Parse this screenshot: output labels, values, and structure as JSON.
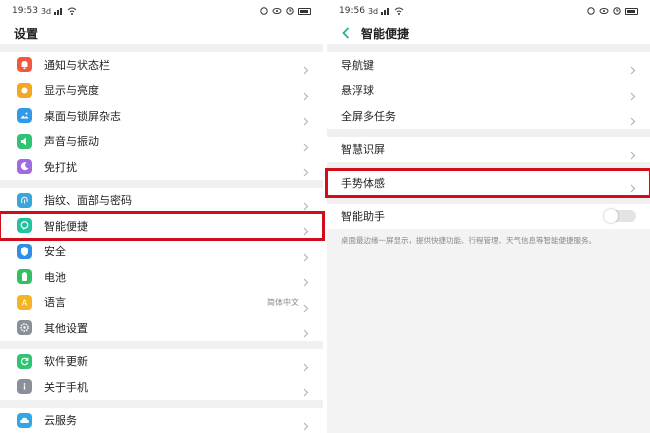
{
  "left": {
    "status_time": "19:53",
    "status_signal": "3d",
    "title": "设置",
    "groups": [
      [
        {
          "label": "通知与状态栏",
          "icon": "notification-bell-icon",
          "color": "#f0593f"
        },
        {
          "label": "显示与亮度",
          "icon": "brightness-icon",
          "color": "#f5a623"
        },
        {
          "label": "桌面与锁屏杂志",
          "icon": "wallpaper-icon",
          "color": "#2f9be8"
        },
        {
          "label": "声音与振动",
          "icon": "speaker-icon",
          "color": "#2fc472"
        },
        {
          "label": "免打扰",
          "icon": "moon-icon",
          "color": "#a06be0"
        }
      ],
      [
        {
          "label": "指纹、面部与密码",
          "icon": "fingerprint-icon",
          "color": "#3aa5d8"
        },
        {
          "label": "智能便捷",
          "icon": "smart-assist-icon",
          "color": "#22c2a0"
        },
        {
          "label": "安全",
          "icon": "shield-icon",
          "color": "#2f8fe8"
        },
        {
          "label": "电池",
          "icon": "battery-icon",
          "color": "#33c063"
        },
        {
          "label": "语言",
          "icon": "language-icon",
          "color": "#f5b523",
          "value": "简体中文"
        },
        {
          "label": "其他设置",
          "icon": "gear-icon",
          "color": "#8a8f99"
        }
      ],
      [
        {
          "label": "软件更新",
          "icon": "update-icon",
          "color": "#2fc472"
        },
        {
          "label": "关于手机",
          "icon": "info-icon",
          "color": "#8a8f99"
        }
      ],
      [
        {
          "label": "云服务",
          "icon": "cloud-icon",
          "color": "#31a8e6"
        }
      ]
    ]
  },
  "right": {
    "status_time": "19:56",
    "status_signal": "3d",
    "title": "智能便捷",
    "accent": "#22b59a",
    "groups": [
      [
        {
          "label": "导航键"
        },
        {
          "label": "悬浮球"
        },
        {
          "label": "全屏多任务"
        }
      ],
      [
        {
          "label": "智慧识屏"
        }
      ],
      [
        {
          "label": "手势体感"
        }
      ]
    ],
    "assistant_label": "智能助手",
    "assistant_on": false,
    "assistant_desc": "桌面最边缘一屏显示，提供快捷功能、行程管理、天气信息等智能便捷服务。"
  },
  "highlight_color": "#d10d1a"
}
